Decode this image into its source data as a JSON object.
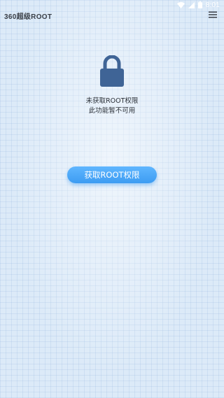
{
  "status_bar": {
    "time": "8:01",
    "icons": [
      "wifi-icon",
      "signal-icon",
      "battery-icon"
    ]
  },
  "header": {
    "app_name": "360超级ROOT",
    "menu_icon": "hamburger-menu-icon"
  },
  "main": {
    "lock_icon": "lock-icon",
    "lock_color": "#3f6496",
    "status_line_1": "未获取ROOT权限",
    "status_line_2": "此功能暂不可用",
    "root_button_label": "获取ROOT权限",
    "accent_color": "#4aa8f8"
  }
}
